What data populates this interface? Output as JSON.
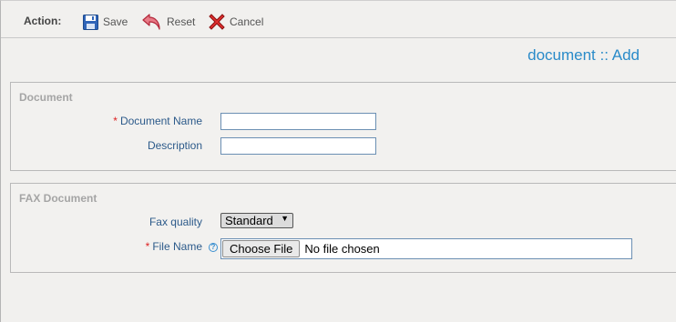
{
  "toolbar": {
    "action_label": "Action:",
    "save_label": "Save",
    "reset_label": "Reset",
    "cancel_label": "Cancel"
  },
  "page_title": "document :: Add",
  "document_section": {
    "legend": "Document",
    "fields": {
      "name_label": "Document Name",
      "name_required": "*",
      "name_value": "",
      "description_label": "Description",
      "description_value": ""
    }
  },
  "fax_section": {
    "legend": "FAX Document",
    "quality_label": "Fax quality",
    "quality_selected": "Standard",
    "file_label": "File Name",
    "file_required": "*",
    "choose_file_label": "Choose File",
    "file_status": "No file chosen"
  },
  "colors": {
    "accent": "#2a8bc9",
    "label": "#2c5a8a",
    "required": "#dd2222",
    "legend": "#a5a5a5",
    "background": "#f1f0ee"
  },
  "icons": {
    "save": "floppy-disk-icon",
    "reset": "undo-arrow-icon",
    "cancel": "red-x-icon",
    "help": "question-help-icon"
  }
}
